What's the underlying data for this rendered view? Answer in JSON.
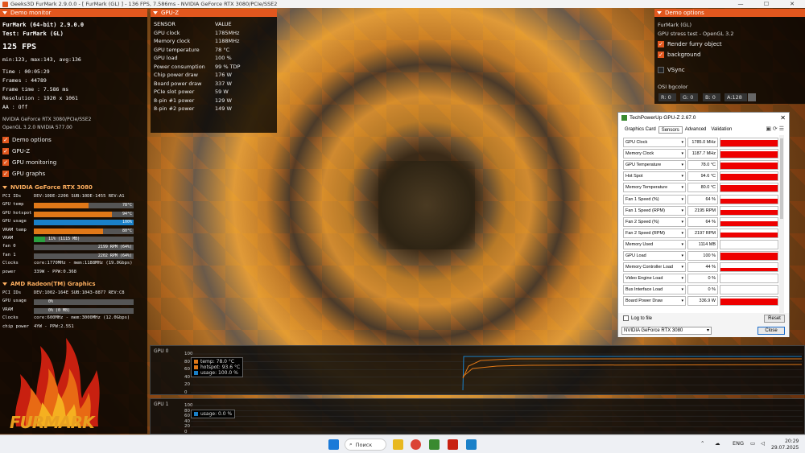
{
  "window": {
    "title": "Geeks3D FurMark 2.9.0.0 - [ FurMark (GL) ] - 136 FPS, 7.586ms - NVIDIA GeForce RTX 3080/PCIe/SSE2",
    "minimize": "—",
    "maximize": "☐",
    "close": "✕"
  },
  "monitor": {
    "header": "Demo monitor",
    "app": "FurMark (64-bit) 2.9.0.0",
    "test": "Test: FurMark (GL)",
    "fps": "125 FPS",
    "minmax": "min:123, max:143, avg:136",
    "time": "Time      :  00:05:29",
    "frames": "Frames    :  44789",
    "frametime": "Frame time :  7.586 ms",
    "resolution": "Resolution :  1920 x 1061",
    "aa": "AA        :  Off",
    "renderer": "NVIDIA GeForce RTX 3080/PCIe/SSE2",
    "opengl": "OpenGL 3.2.0 NVIDIA 577.00",
    "checks": [
      {
        "label": "Demo options",
        "checked": true
      },
      {
        "label": "GPU-Z",
        "checked": true
      },
      {
        "label": "GPU monitoring",
        "checked": true
      },
      {
        "label": "GPU graphs",
        "checked": true
      }
    ],
    "check_mark": "✓"
  },
  "gpu1": {
    "title": "NVIDIA GeForce RTX 3080",
    "rows": [
      {
        "label": "PCI IDs",
        "text": "DEV:10DE-2206 SUB:10DE-1455 REV:A1"
      },
      {
        "label": "GPU temp",
        "bar": 0.55,
        "color": "#e07818",
        "text": "78°C"
      },
      {
        "label": "GPU hotspot",
        "bar": 0.78,
        "color": "#e07818",
        "text": "94°C"
      },
      {
        "label": "GPU usage",
        "bar": 1.0,
        "color": "#1a80c8",
        "text": "100%"
      },
      {
        "label": "VRAM temp",
        "bar": 0.69,
        "color": "#e07818",
        "text": "80°C"
      },
      {
        "label": "VRAM",
        "bar": 0.11,
        "color": "#2aa040",
        "text": "11% (1115 MB)",
        "left": true
      },
      {
        "label": "fan 0",
        "bar": 0.0,
        "color": "#888",
        "text": "2199 RPM (64%)"
      },
      {
        "label": "fan 1",
        "bar": 0.0,
        "color": "#888",
        "text": "2202 RPM (64%)"
      },
      {
        "label": "Clocks",
        "text": "core:1770MHz - mem:1188MHz (19.0Gbps)"
      },
      {
        "label": "power",
        "text": "339W - PPW:0.368"
      }
    ]
  },
  "gpu2": {
    "title": "AMD Radeon(TM) Graphics",
    "rows": [
      {
        "label": "PCI IDs",
        "text": "DEV:1002-164E SUB:1043-8877 REV:C8"
      },
      {
        "label": "GPU usage",
        "bar": 0.0,
        "color": "#1a80c8",
        "text": "0%",
        "left": true
      },
      {
        "label": "VRAM",
        "bar": 0.0,
        "color": "#2aa040",
        "text": "0% (0 MB)",
        "left": true
      },
      {
        "label": "Clocks",
        "text": "core:600MHz - mem:3000MHz (12.0Gbps)"
      },
      {
        "label": "chip power",
        "text": "4YW - PPW:2.551"
      }
    ]
  },
  "logo_text": "FURMARK",
  "gpuz": {
    "header": "GPU-Z",
    "col_sensor": "SENSOR",
    "col_value": "VALUE",
    "rows": [
      [
        "GPU clock",
        "1785MHz"
      ],
      [
        "Memory clock",
        "1188MHz"
      ],
      [
        "GPU temperature",
        "78 °C"
      ],
      [
        "GPU load",
        "100 %"
      ],
      [
        "Power consumption",
        "99 % TDP"
      ],
      [
        "Chip power draw",
        "176 W"
      ],
      [
        "Board power draw",
        "337 W"
      ],
      [
        "PCIe slot power",
        "59 W"
      ],
      [
        "8-pin #1 power",
        "129 W"
      ],
      [
        "8-pin #2 power",
        "149 W"
      ]
    ]
  },
  "options": {
    "header": "Demo options",
    "name": "FurMark (GL)",
    "desc": "GPU stress test - OpenGL 3.2",
    "render_furry": "Render furry object",
    "background": "background",
    "vsync": "VSync",
    "osi": "OSI bgcolor",
    "fields": [
      "R: 0",
      "G: 0",
      "B: 0",
      "A:128"
    ]
  },
  "tpu": {
    "title": "TechPowerUp GPU-Z 2.67.0",
    "close": "✕",
    "tabs": [
      "Graphics Card",
      "Sensors",
      "Advanced",
      "Validation"
    ],
    "active_tab": "Sensors",
    "tool_icons": "▣ ⟳ ☰",
    "dropdown": "▾",
    "sensors": [
      {
        "name": "GPU Clock",
        "value": "1785.0 MHz",
        "level": 0.85
      },
      {
        "name": "Memory Clock",
        "value": "1187.7 MHz",
        "level": 0.85
      },
      {
        "name": "GPU Temperature",
        "value": "78.0 °C",
        "level": 0.8
      },
      {
        "name": "Hot Spot",
        "value": "94.6 °C",
        "level": 0.85
      },
      {
        "name": "Memory Temperature",
        "value": "80.0 °C",
        "level": 0.8
      },
      {
        "name": "Fan 1 Speed (%)",
        "value": "64 %",
        "level": 0.55
      },
      {
        "name": "Fan 1 Speed (RPM)",
        "value": "2195 RPM",
        "level": 0.55
      },
      {
        "name": "Fan 2 Speed (%)",
        "value": "64 %",
        "level": 0.55
      },
      {
        "name": "Fan 2 Speed (RPM)",
        "value": "2197 RPM",
        "level": 0.55
      },
      {
        "name": "Memory Used",
        "value": "1114 MB",
        "level": 0.0
      },
      {
        "name": "GPU Load",
        "value": "100 %",
        "level": 0.95
      },
      {
        "name": "Memory Controller Load",
        "value": "44 %",
        "level": 0.45
      },
      {
        "name": "Video Engine Load",
        "value": "0 %",
        "level": 0.0
      },
      {
        "name": "Bus Interface Load",
        "value": "0 %",
        "level": 0.0
      },
      {
        "name": "Board Power Draw",
        "value": "336.9 W",
        "level": 0.85
      }
    ],
    "log_label": "Log to file",
    "reset": "Reset",
    "device": "NVIDIA GeForce RTX 3080",
    "close_btn": "Close"
  },
  "graphs": {
    "gpu0": {
      "label": "GPU 0",
      "yticks": [
        "100",
        "80",
        "60",
        "40",
        "20",
        "0"
      ],
      "legend": [
        {
          "text": "temp: 78.0 °C",
          "color": "#e07818"
        },
        {
          "text": "hotspot: 93.6 °C",
          "color": "#e07818"
        },
        {
          "text": "usage: 100.0 %",
          "color": "#1a80c8"
        }
      ]
    },
    "gpu1": {
      "label": "GPU 1",
      "yticks": [
        "100",
        "80",
        "60",
        "40",
        "20",
        "0"
      ],
      "legend": [
        {
          "text": "usage: 0.0 %",
          "color": "#1a80c8"
        }
      ]
    }
  },
  "taskbar": {
    "search": "Поиск",
    "lang": "ENG",
    "time": "20:29",
    "date": "29.07.2025"
  }
}
